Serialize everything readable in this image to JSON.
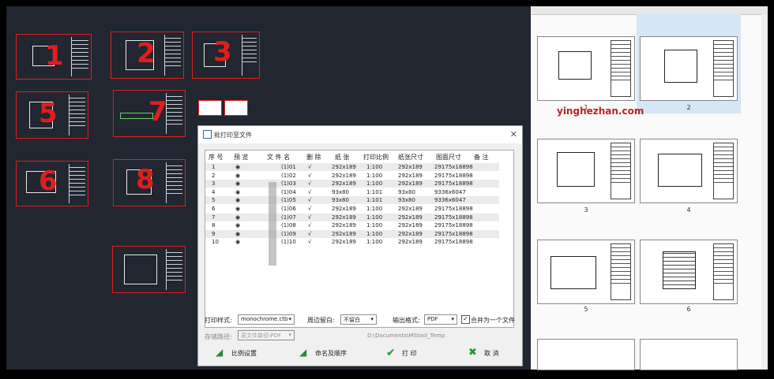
{
  "cad_labels": {
    "n1": "1",
    "n2": "2",
    "n3": "3",
    "n5": "5",
    "n6": "6",
    "n7": "7",
    "n8": "8"
  },
  "dialog": {
    "title": "批打印至文件",
    "columns": [
      "序 号",
      "预 览",
      "文 件 名",
      "删 除",
      "纸 张",
      "打印比例",
      "纸张尺寸",
      "图面尺寸",
      "备 注"
    ],
    "rows": [
      {
        "no": "1",
        "file": "(1)01",
        "del": "√",
        "paper": "292x189",
        "scale": "1:100",
        "psize": "292x189",
        "dsize": "29175x18898"
      },
      {
        "no": "2",
        "file": "(1)02",
        "del": "√",
        "paper": "292x189",
        "scale": "1:100",
        "psize": "292x189",
        "dsize": "29175x18898"
      },
      {
        "no": "3",
        "file": "(1)03",
        "del": "√",
        "paper": "292x189",
        "scale": "1:100",
        "psize": "292x189",
        "dsize": "29175x18898"
      },
      {
        "no": "4",
        "file": "(1)04",
        "del": "√",
        "paper": "93x80",
        "scale": "1:101",
        "psize": "93x80",
        "dsize": "9336x6047"
      },
      {
        "no": "5",
        "file": "(1)05",
        "del": "√",
        "paper": "93x80",
        "scale": "1:101",
        "psize": "93x80",
        "dsize": "9336x6047"
      },
      {
        "no": "6",
        "file": "(1)06",
        "del": "√",
        "paper": "292x189",
        "scale": "1:100",
        "psize": "292x189",
        "dsize": "29175x18898"
      },
      {
        "no": "7",
        "file": "(1)07",
        "del": "√",
        "paper": "292x189",
        "scale": "1:100",
        "psize": "292x189",
        "dsize": "29175x18898"
      },
      {
        "no": "8",
        "file": "(1)08",
        "del": "√",
        "paper": "292x189",
        "scale": "1:100",
        "psize": "292x189",
        "dsize": "29175x18898"
      },
      {
        "no": "9",
        "file": "(1)09",
        "del": "√",
        "paper": "292x189",
        "scale": "1:100",
        "psize": "292x189",
        "dsize": "29175x18898"
      },
      {
        "no": "10",
        "file": "(1)10",
        "del": "√",
        "paper": "292x189",
        "scale": "1:100",
        "psize": "292x189",
        "dsize": "29175x18898"
      }
    ],
    "print_style_label": "打印样式:",
    "print_style_value": "monochrome.ctb",
    "margin_label": "周边留白:",
    "margin_value": "不留白",
    "format_label": "输出格式:",
    "format_value": "PDF",
    "merge_label": "合并为一个文件",
    "merge_checked": "✓",
    "path_label": "存储路径:",
    "path_value": "原文件路径\\PDF",
    "path_text": "D:\\Documents\\MStool_Temp",
    "btn_scale": "比例设置",
    "btn_rename": "命名及顺序",
    "btn_print": "打 印",
    "btn_cancel": "取 消"
  },
  "viewer": {
    "watermark": "yinghezhan.com",
    "pages": [
      "1",
      "2",
      "3",
      "4",
      "5",
      "6"
    ]
  }
}
